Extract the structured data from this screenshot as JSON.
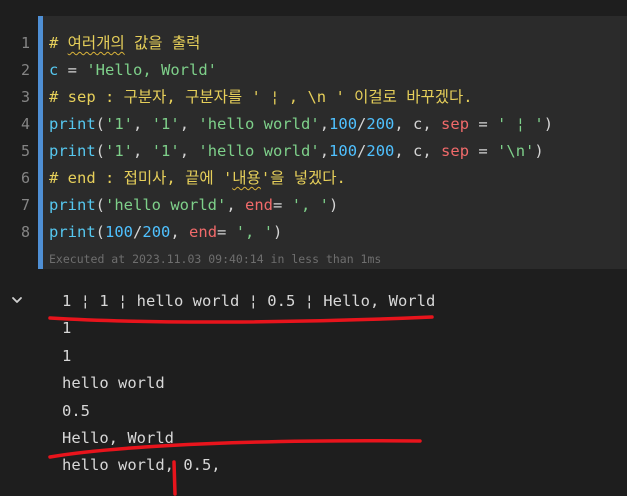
{
  "cell": {
    "line_numbers": [
      "1",
      "2",
      "3",
      "4",
      "5",
      "6",
      "7",
      "8"
    ],
    "code_lines": [
      [
        {
          "t": "# ",
          "c": "cm"
        },
        {
          "t": "여러개의",
          "c": "cm squig"
        },
        {
          "t": " 값을 출력",
          "c": "cm"
        }
      ],
      [
        {
          "t": "c",
          "c": "id"
        },
        {
          "t": " = ",
          "c": "plain"
        },
        {
          "t": "'Hello, World'",
          "c": "str"
        }
      ],
      [
        {
          "t": "# sep : 구분자, 구분자를 ' ¦ , \\n ' 이걸로 바꾸겠다.",
          "c": "cm"
        }
      ],
      [
        {
          "t": "print",
          "c": "id"
        },
        {
          "t": "(",
          "c": "plain"
        },
        {
          "t": "'1'",
          "c": "str"
        },
        {
          "t": ", ",
          "c": "plain"
        },
        {
          "t": "'1'",
          "c": "str"
        },
        {
          "t": ", ",
          "c": "plain"
        },
        {
          "t": "'hello world'",
          "c": "str"
        },
        {
          "t": ",",
          "c": "plain"
        },
        {
          "t": "100",
          "c": "num"
        },
        {
          "t": "/",
          "c": "plain"
        },
        {
          "t": "200",
          "c": "num"
        },
        {
          "t": ", c, ",
          "c": "plain"
        },
        {
          "t": "sep",
          "c": "kw"
        },
        {
          "t": " = ",
          "c": "plain"
        },
        {
          "t": "' ¦ '",
          "c": "str"
        },
        {
          "t": ")",
          "c": "plain"
        }
      ],
      [
        {
          "t": "print",
          "c": "id"
        },
        {
          "t": "(",
          "c": "plain"
        },
        {
          "t": "'1'",
          "c": "str"
        },
        {
          "t": ", ",
          "c": "plain"
        },
        {
          "t": "'1'",
          "c": "str"
        },
        {
          "t": ", ",
          "c": "plain"
        },
        {
          "t": "'hello world'",
          "c": "str"
        },
        {
          "t": ",",
          "c": "plain"
        },
        {
          "t": "100",
          "c": "num"
        },
        {
          "t": "/",
          "c": "plain"
        },
        {
          "t": "200",
          "c": "num"
        },
        {
          "t": ", c, ",
          "c": "plain"
        },
        {
          "t": "sep",
          "c": "kw"
        },
        {
          "t": " = ",
          "c": "plain"
        },
        {
          "t": "'\\n'",
          "c": "str"
        },
        {
          "t": ")",
          "c": "plain"
        }
      ],
      [
        {
          "t": "# end : 접미사, 끝에 '",
          "c": "cm"
        },
        {
          "t": "내용",
          "c": "cm squig"
        },
        {
          "t": "'을 넣겠다.",
          "c": "cm"
        }
      ],
      [
        {
          "t": "print",
          "c": "id"
        },
        {
          "t": "(",
          "c": "plain"
        },
        {
          "t": "'hello world'",
          "c": "str"
        },
        {
          "t": ", ",
          "c": "plain"
        },
        {
          "t": "end",
          "c": "kw"
        },
        {
          "t": "= ",
          "c": "plain"
        },
        {
          "t": "', '",
          "c": "str"
        },
        {
          "t": ")",
          "c": "plain"
        }
      ],
      [
        {
          "t": "print",
          "c": "id"
        },
        {
          "t": "(",
          "c": "plain"
        },
        {
          "t": "100",
          "c": "num"
        },
        {
          "t": "/",
          "c": "plain"
        },
        {
          "t": "200",
          "c": "num"
        },
        {
          "t": ", ",
          "c": "plain"
        },
        {
          "t": "end",
          "c": "kw"
        },
        {
          "t": "= ",
          "c": "plain"
        },
        {
          "t": "', '",
          "c": "str"
        },
        {
          "t": ")",
          "c": "plain"
        }
      ]
    ],
    "execution_status": "Executed at 2023.11.03 09:40:14 in less than 1ms"
  },
  "output": {
    "lines": [
      "1 ¦ 1 ¦ hello world ¦ 0.5 ¦ Hello, World",
      "1",
      "1",
      "hello world",
      "0.5",
      "Hello, World",
      "hello world, 0.5,"
    ]
  },
  "colors": {
    "background": "#1e1e1e",
    "cell_background": "#2b2b2b",
    "cell_accent_bar": "#4f8fd4",
    "comment": "#e6cf5a",
    "identifier": "#56c8f0",
    "string": "#7ed08a",
    "keyword_arg": "#f16a6a",
    "annotation_ink": "#e8141c"
  },
  "icons": {
    "output_toggle": "chevron-down-icon"
  }
}
